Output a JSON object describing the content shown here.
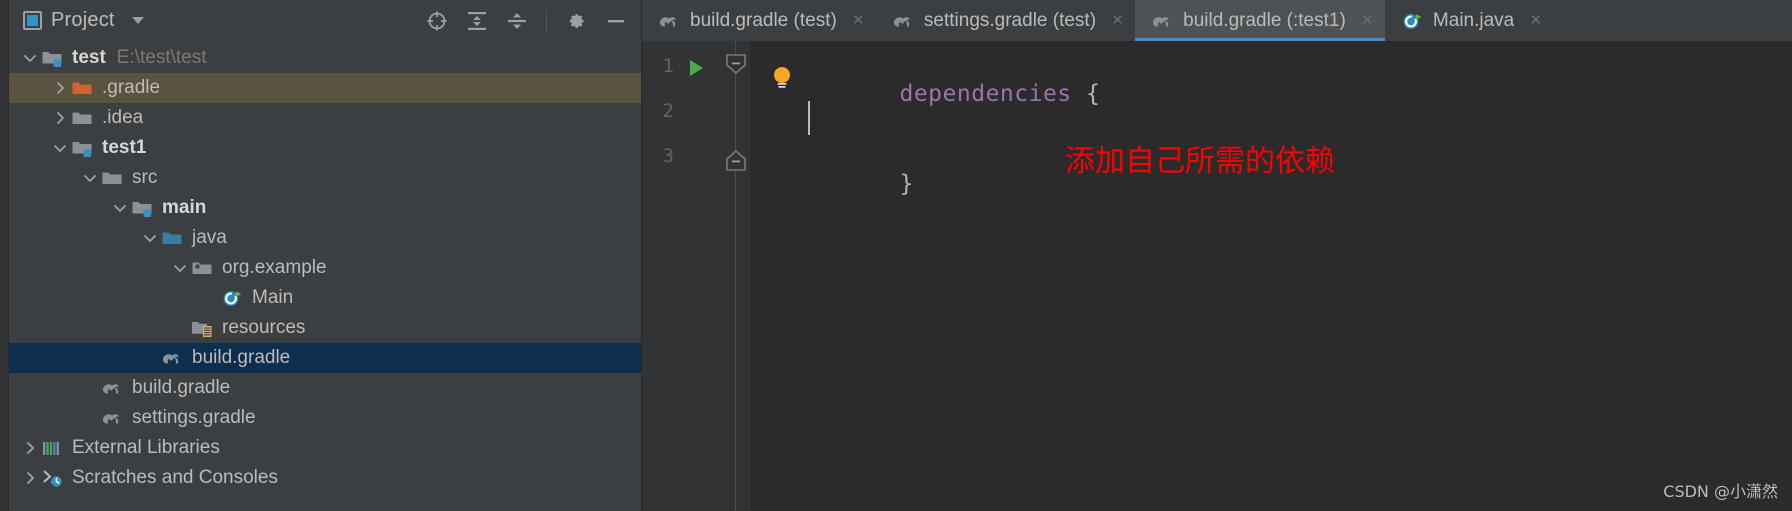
{
  "panel": {
    "title": "Project",
    "icons": {
      "project_icon": "project-window-icon",
      "dropdown": "chevron-down-icon",
      "locate": "locate-target-icon",
      "expand_all": "expand-all-icon",
      "collapse_all": "collapse-all-icon",
      "settings": "gear-icon",
      "hide": "minimize-icon"
    }
  },
  "tree": [
    {
      "depth": 0,
      "twisty": "expanded",
      "icon": "module-folder-icon",
      "label": "test",
      "bold": true,
      "sublabel": "E:\\test\\test",
      "state": "normal"
    },
    {
      "depth": 1,
      "twisty": "collapsed",
      "icon": "gradle-folder-icon",
      "label": ".gradle",
      "bold": false,
      "sublabel": "",
      "state": "hover-brown"
    },
    {
      "depth": 1,
      "twisty": "collapsed",
      "icon": "folder-icon",
      "label": ".idea",
      "bold": false,
      "sublabel": "",
      "state": "normal"
    },
    {
      "depth": 1,
      "twisty": "expanded",
      "icon": "module-folder-icon",
      "label": "test1",
      "bold": true,
      "sublabel": "",
      "state": "normal"
    },
    {
      "depth": 2,
      "twisty": "expanded",
      "icon": "folder-icon",
      "label": "src",
      "bold": false,
      "sublabel": "",
      "state": "normal"
    },
    {
      "depth": 3,
      "twisty": "expanded",
      "icon": "module-folder-icon",
      "label": "main",
      "bold": true,
      "sublabel": "",
      "state": "normal"
    },
    {
      "depth": 4,
      "twisty": "expanded",
      "icon": "source-root-folder-icon",
      "label": "java",
      "bold": false,
      "sublabel": "",
      "state": "normal"
    },
    {
      "depth": 5,
      "twisty": "expanded",
      "icon": "package-icon",
      "label": "org.example",
      "bold": false,
      "sublabel": "",
      "state": "normal"
    },
    {
      "depth": 6,
      "twisty": "none",
      "icon": "java-class-run-icon",
      "label": "Main",
      "bold": false,
      "sublabel": "",
      "state": "normal"
    },
    {
      "depth": 5,
      "twisty": "none",
      "icon": "resources-folder-icon",
      "label": "resources",
      "bold": false,
      "sublabel": "",
      "state": "normal"
    },
    {
      "depth": 4,
      "twisty": "none",
      "icon": "gradle-file-icon",
      "label": "build.gradle",
      "bold": false,
      "sublabel": "",
      "state": "selected"
    },
    {
      "depth": 2,
      "twisty": "none",
      "icon": "gradle-file-icon",
      "label": "build.gradle",
      "bold": false,
      "sublabel": "",
      "state": "normal"
    },
    {
      "depth": 2,
      "twisty": "none",
      "icon": "gradle-file-icon",
      "label": "settings.gradle",
      "bold": false,
      "sublabel": "",
      "state": "normal"
    },
    {
      "depth": 0,
      "twisty": "collapsed",
      "icon": "external-libraries-icon",
      "label": "External Libraries",
      "bold": false,
      "sublabel": "",
      "state": "normal"
    },
    {
      "depth": 0,
      "twisty": "collapsed",
      "icon": "scratches-icon",
      "label": "Scratches and Consoles",
      "bold": false,
      "sublabel": "",
      "state": "normal"
    }
  ],
  "tabs": [
    {
      "icon": "gradle-file-icon",
      "label": "build.gradle (test)",
      "close": "×",
      "active": false
    },
    {
      "icon": "gradle-file-icon",
      "label": "settings.gradle (test)",
      "close": "×",
      "active": false
    },
    {
      "icon": "gradle-file-icon",
      "label": "build.gradle (:test1)",
      "close": "×",
      "active": true
    },
    {
      "icon": "java-class-run-icon",
      "label": "Main.java",
      "close": "×",
      "active": false
    }
  ],
  "editor": {
    "line_numbers": [
      "1",
      "2",
      "3"
    ],
    "lines": [
      {
        "keyword": "dependencies",
        "brace": " {"
      },
      {
        "keyword": "",
        "brace": ""
      },
      {
        "keyword": "",
        "brace": "}"
      }
    ],
    "gutter_icons": {
      "run": "run-green-triangle-icon",
      "fold_open": "fold-collapse-icon",
      "fold_end": "fold-end-icon",
      "intention": "intention-bulb-icon"
    },
    "annotation": "添加自己所需的依赖",
    "annotation_color": "#ff0000"
  },
  "watermark": "CSDN @小潇然",
  "colors": {
    "panel_bg": "#3c3f41",
    "editor_bg": "#2b2b2b",
    "gutter_bg": "#313335",
    "tab_active_bg": "#4e5254",
    "tab_underline": "#4a88c7",
    "row_selected": "#0d2e4d",
    "row_hover": "#5b5340",
    "text": "#bbbbbb",
    "keyword_purple": "#9876aa",
    "annotation_red": "#ff0000"
  }
}
